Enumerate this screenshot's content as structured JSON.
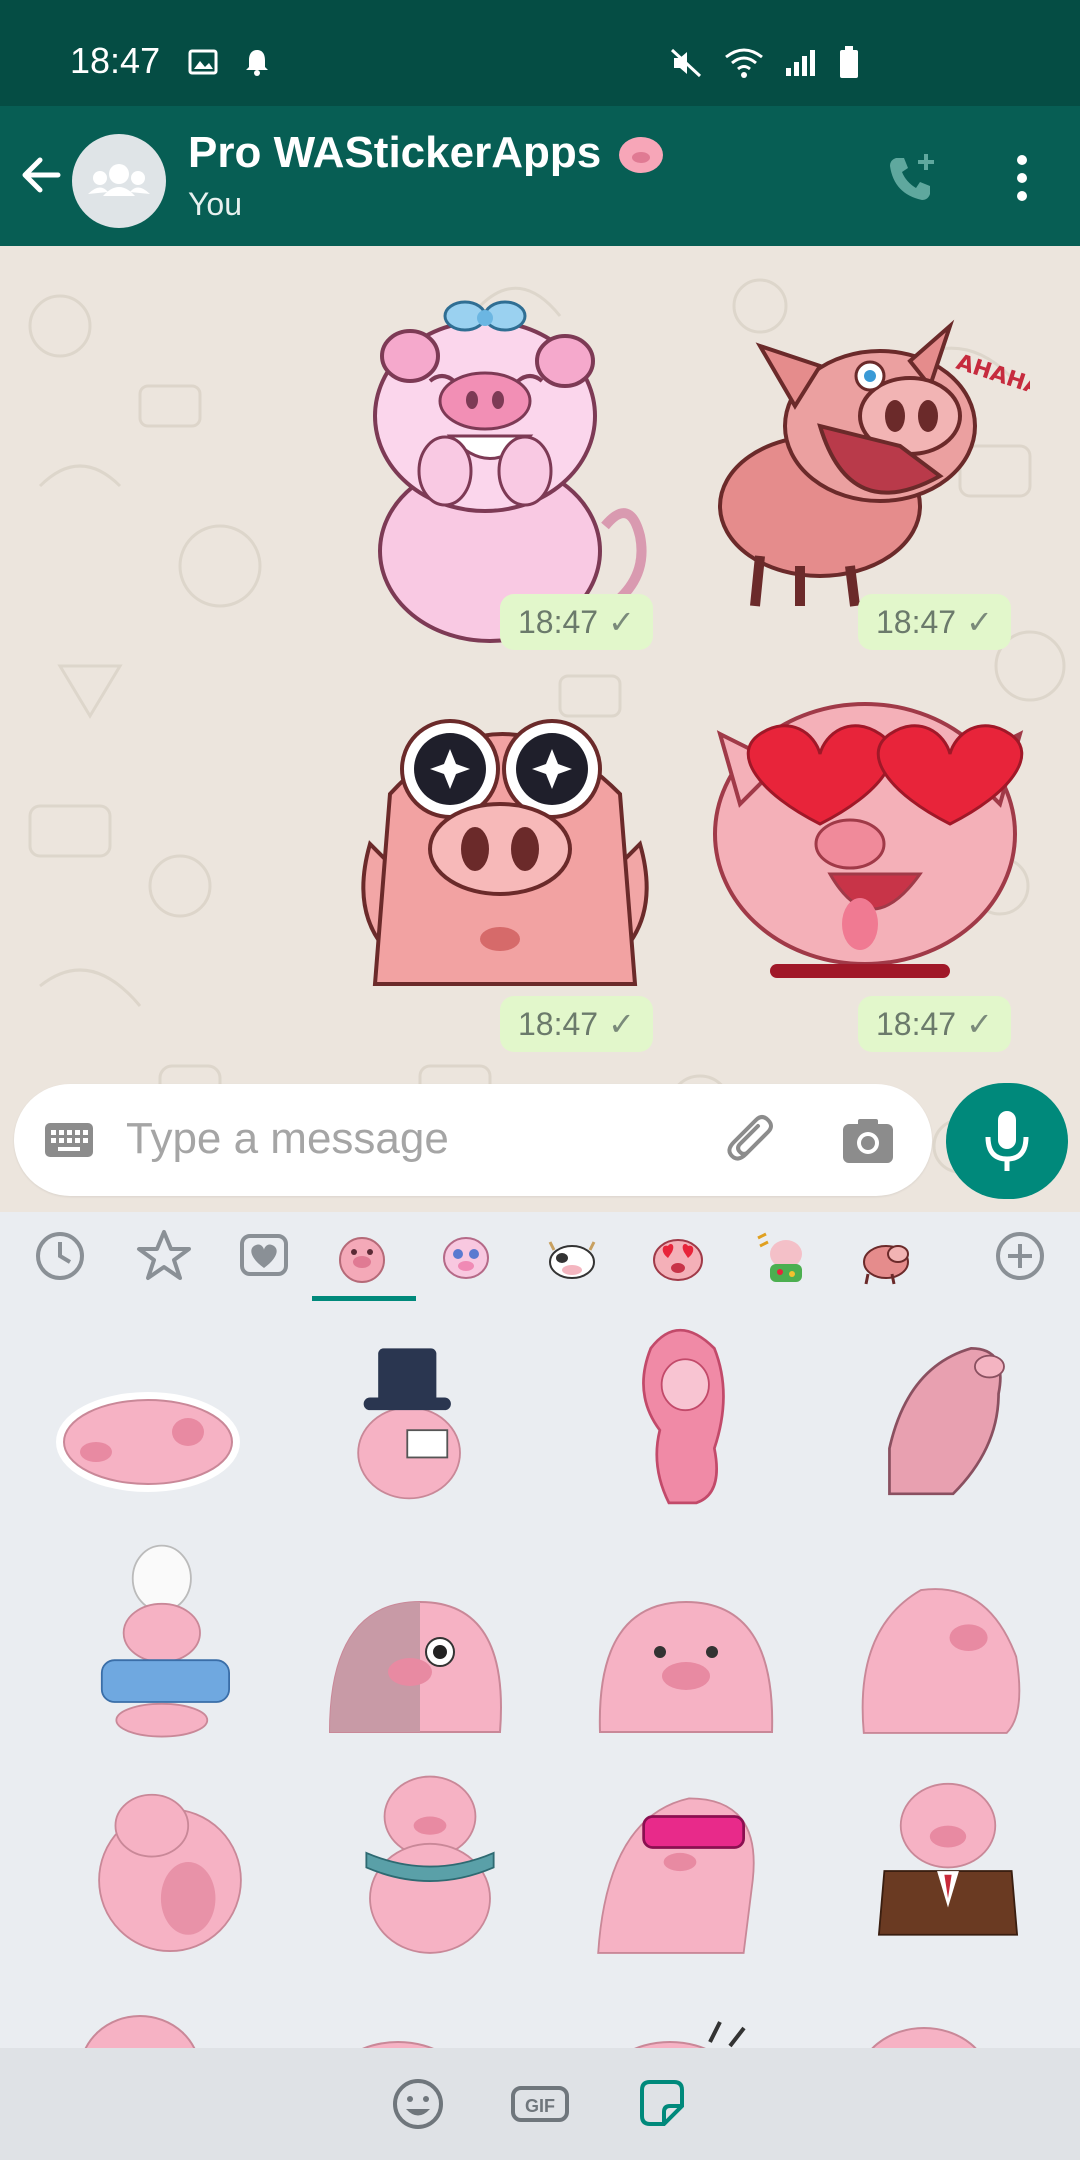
{
  "status_bar": {
    "time": "18:47",
    "icons": [
      "gallery-icon",
      "notification-bell-icon",
      "mute-icon",
      "wifi-icon",
      "signal-icon",
      "battery-icon"
    ]
  },
  "header": {
    "title": "Pro WAStickerApps",
    "title_emoji": "pig-face-emoji",
    "subtitle": "You",
    "icons": [
      "back-arrow-icon",
      "group-avatar-icon",
      "add-call-icon",
      "more-vert-icon"
    ]
  },
  "messages": [
    {
      "type": "sticker",
      "sticker": "pink-pig-laughing-with-bow",
      "time": "18:47",
      "status": "sent"
    },
    {
      "type": "sticker",
      "sticker": "boar-laughing-ahaha",
      "time": "18:47",
      "status": "sent",
      "sticker_text": "AHAHA"
    },
    {
      "type": "sticker",
      "sticker": "pig-sparkly-crying-eyes",
      "time": "18:47",
      "status": "sent"
    },
    {
      "type": "sticker",
      "sticker": "pig-heart-eyes",
      "time": "18:47",
      "status": "sent"
    }
  ],
  "composer": {
    "placeholder": "Type a message",
    "icons": [
      "keyboard-icon",
      "attach-icon",
      "camera-icon",
      "mic-icon"
    ]
  },
  "sticker_tabs": [
    {
      "icon": "recent-clock-icon",
      "active": false
    },
    {
      "icon": "star-icon",
      "active": false
    },
    {
      "icon": "heart-icon",
      "active": false
    },
    {
      "icon": "pig-pack-1",
      "active": true
    },
    {
      "icon": "pig-pack-2",
      "active": false
    },
    {
      "icon": "cow-pack",
      "active": false
    },
    {
      "icon": "pig-heart-pack",
      "active": false
    },
    {
      "icon": "pig-haha-pack",
      "active": false
    },
    {
      "icon": "boar-pack",
      "active": false
    },
    {
      "icon": "add-pack-icon",
      "active": false
    }
  ],
  "sticker_grid": [
    "pig-sleeping",
    "pig-top-hat",
    "pig-pink-hair",
    "pig-sniffing-up",
    "pig-with-hat-blue-shirt",
    "pig-big-eyes",
    "pig-front",
    "pig-looking-up",
    "pig-sitting-back",
    "pig-scarf",
    "pig-sunglasses",
    "pig-suit",
    "pig-partial-1",
    "pig-partial-2",
    "pig-partial-3",
    "pig-partial-4"
  ],
  "bottom_bar": {
    "icons": [
      "emoji-icon",
      "gif-icon",
      "sticker-icon"
    ],
    "gif_label": "GIF",
    "active": "sticker-icon"
  },
  "colors": {
    "status_bar": "#054d44",
    "header": "#075e54",
    "accent": "#00897b",
    "bubble": "#e2f7cb",
    "chat_bg": "#ece5dd",
    "panel_bg": "#eaedf1"
  }
}
